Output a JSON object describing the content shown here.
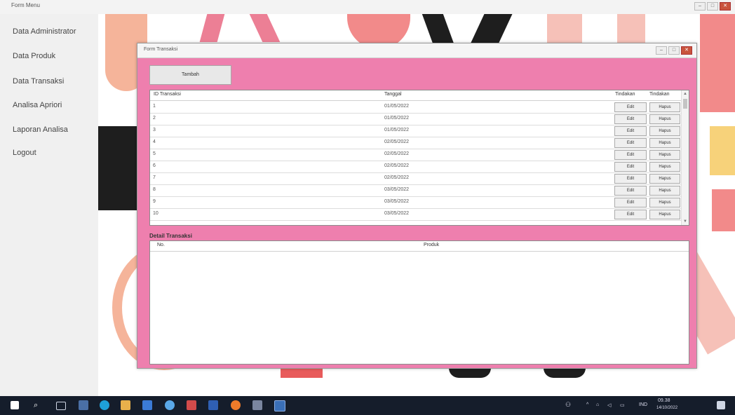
{
  "window": {
    "title": "Form Menu"
  },
  "sidebar": {
    "items": [
      {
        "label": "Data Administrator"
      },
      {
        "label": "Data Produk"
      },
      {
        "label": "Data Transaksi"
      },
      {
        "label": "Analisa Apriori"
      },
      {
        "label": "Laporan Analisa"
      },
      {
        "label": "Logout"
      }
    ]
  },
  "form": {
    "title": "Form Transaksi",
    "add_button": "Tambah",
    "grid": {
      "headers": [
        "ID Transaksi",
        "Tanggal",
        "Tindakan",
        "Tindakan"
      ],
      "edit_label": "Edit",
      "delete_label": "Hapus",
      "rows": [
        {
          "id": "1",
          "date": "01/05/2022"
        },
        {
          "id": "2",
          "date": "01/05/2022"
        },
        {
          "id": "3",
          "date": "01/05/2022"
        },
        {
          "id": "4",
          "date": "02/05/2022"
        },
        {
          "id": "5",
          "date": "02/05/2022"
        },
        {
          "id": "6",
          "date": "02/05/2022"
        },
        {
          "id": "7",
          "date": "02/05/2022"
        },
        {
          "id": "8",
          "date": "03/05/2022"
        },
        {
          "id": "9",
          "date": "03/05/2022"
        },
        {
          "id": "10",
          "date": "03/05/2022"
        }
      ]
    },
    "detail": {
      "label": "Detail Transaksi",
      "headers": [
        "No.",
        "Produk"
      ]
    }
  },
  "taskbar": {
    "lang": "IND",
    "time": "09.38",
    "date": "14/10/2022"
  },
  "colors": {
    "form_background": "#ee7fae",
    "taskbar": "#151d2b"
  }
}
